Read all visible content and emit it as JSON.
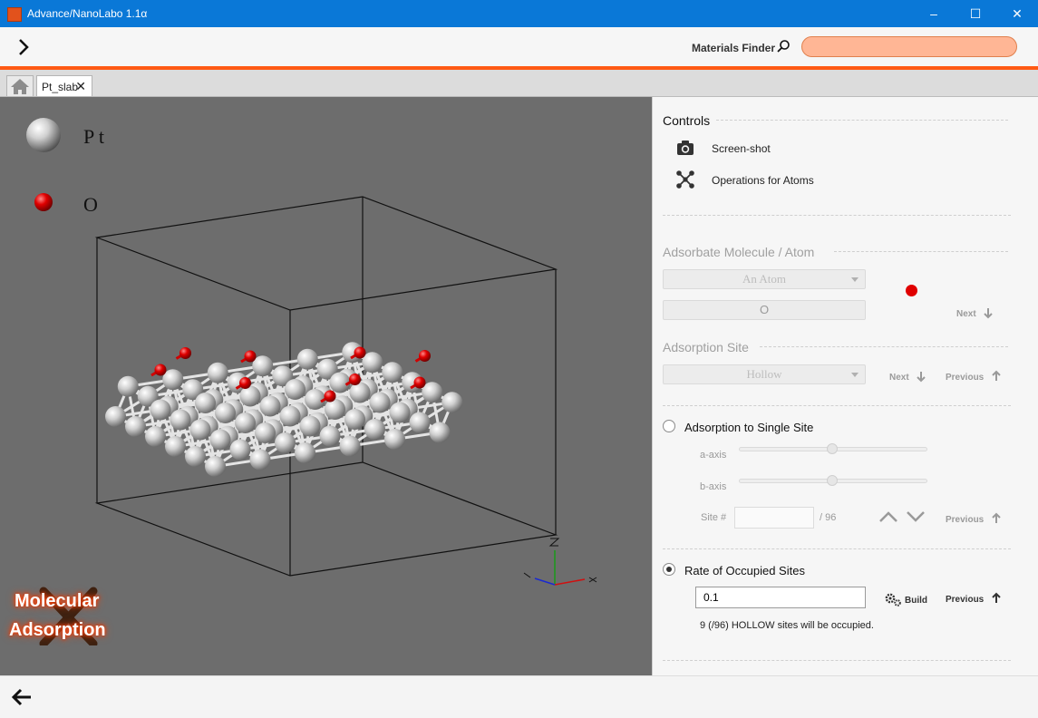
{
  "window": {
    "title": "Advance/NanoLabo 1.1α",
    "minimize": "–",
    "maximize": "☐",
    "close": "✕"
  },
  "header": {
    "menu_icon": "chevron-right-icon",
    "materials_finder_label": "Materials Finder",
    "search_icon": "search-icon",
    "search_value": ""
  },
  "tabs": {
    "home_icon": "home-icon",
    "document_tab": "Pt_slab",
    "close_glyph": "✕"
  },
  "viewer": {
    "legend": [
      {
        "element": "Pt",
        "label": "P t",
        "color": "#d8d8d8"
      },
      {
        "element": "O",
        "label": "O",
        "color": "#e00000"
      }
    ],
    "badge_line1": "Molecular",
    "badge_line2": "Adsorption"
  },
  "controls": {
    "title": "Controls",
    "items": [
      {
        "label": "Screen-shot",
        "icon": "camera-icon"
      },
      {
        "label": "Operations for Atoms",
        "icon": "atoms-icon"
      }
    ]
  },
  "adsorbate": {
    "title": "Adsorbate Molecule / Atom",
    "type_select": "An Atom",
    "element_value": "O",
    "element_color": "#e00000",
    "next_label": "Next"
  },
  "adsorption_site": {
    "title": "Adsorption Site",
    "site_select": "Hollow",
    "next_label": "Next",
    "previous_label": "Previous"
  },
  "single_site": {
    "radio_label": "Adsorption to Single Site",
    "selected": false,
    "a_axis_label": "a-axis",
    "b_axis_label": "b-axis",
    "site_label": "Site #",
    "site_value": "",
    "site_total": "/ 96",
    "previous_label": "Previous"
  },
  "rate": {
    "radio_label": "Rate of Occupied Sites",
    "selected": true,
    "value": "0.1",
    "build_label": "Build",
    "previous_label": "Previous",
    "status": "9 (/96) HOLLOW sites will be occupied."
  },
  "footer": {
    "back_icon": "arrow-left-icon"
  }
}
